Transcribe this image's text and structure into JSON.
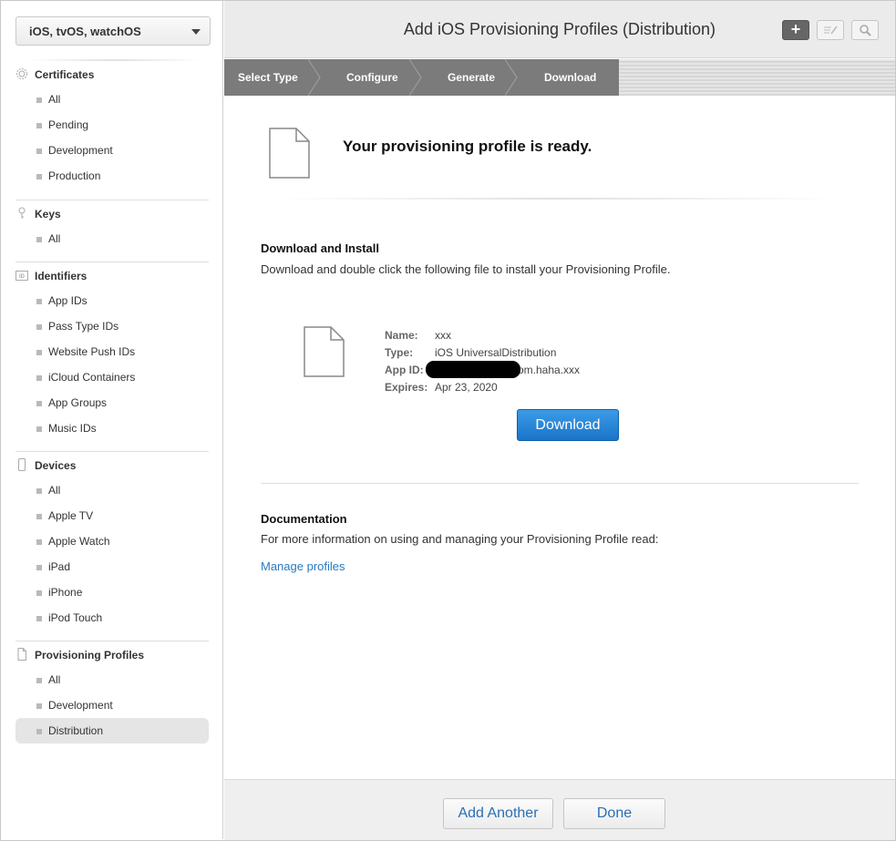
{
  "sidebar": {
    "platform": "iOS, tvOS, watchOS",
    "sections": [
      {
        "title": "Certificates",
        "icon": "certificate-icon",
        "items": [
          "All",
          "Pending",
          "Development",
          "Production"
        ]
      },
      {
        "title": "Keys",
        "icon": "key-icon",
        "items": [
          "All"
        ]
      },
      {
        "title": "Identifiers",
        "icon": "id-icon",
        "items": [
          "App IDs",
          "Pass Type IDs",
          "Website Push IDs",
          "iCloud Containers",
          "App Groups",
          "Music IDs"
        ]
      },
      {
        "title": "Devices",
        "icon": "device-icon",
        "items": [
          "All",
          "Apple TV",
          "Apple Watch",
          "iPad",
          "iPhone",
          "iPod Touch"
        ]
      },
      {
        "title": "Provisioning Profiles",
        "icon": "document-icon",
        "items": [
          "All",
          "Development",
          "Distribution"
        ]
      }
    ],
    "active_item": "Distribution"
  },
  "header": {
    "title": "Add iOS Provisioning Profiles (Distribution)",
    "add_icon": "plus-icon",
    "edit_icon": "edit-icon",
    "search_icon": "search-icon"
  },
  "steps": [
    "Select Type",
    "Configure",
    "Generate",
    "Download"
  ],
  "main": {
    "ready_title": "Your provisioning profile is ready.",
    "download_section": {
      "title": "Download and Install",
      "text": "Download and double click the following file to install your Provisioning Profile."
    },
    "profile": {
      "name_label": "Name:",
      "name": "xxx",
      "type_label": "Type:",
      "type": "iOS UniversalDistribution",
      "app_id_label": "App ID:",
      "app_id": "om.haha.xxx",
      "expires_label": "Expires:",
      "expires": "Apr 23, 2020"
    },
    "download_button": "Download",
    "documentation": {
      "title": "Documentation",
      "text": "For more information on using and managing your Provisioning Profile read:",
      "link": "Manage profiles"
    }
  },
  "footer": {
    "add_another": "Add Another",
    "done": "Done"
  },
  "colors": {
    "accent": "#1a74c9",
    "link": "#2a79bf",
    "steps_bar": "#7b7b7b"
  }
}
